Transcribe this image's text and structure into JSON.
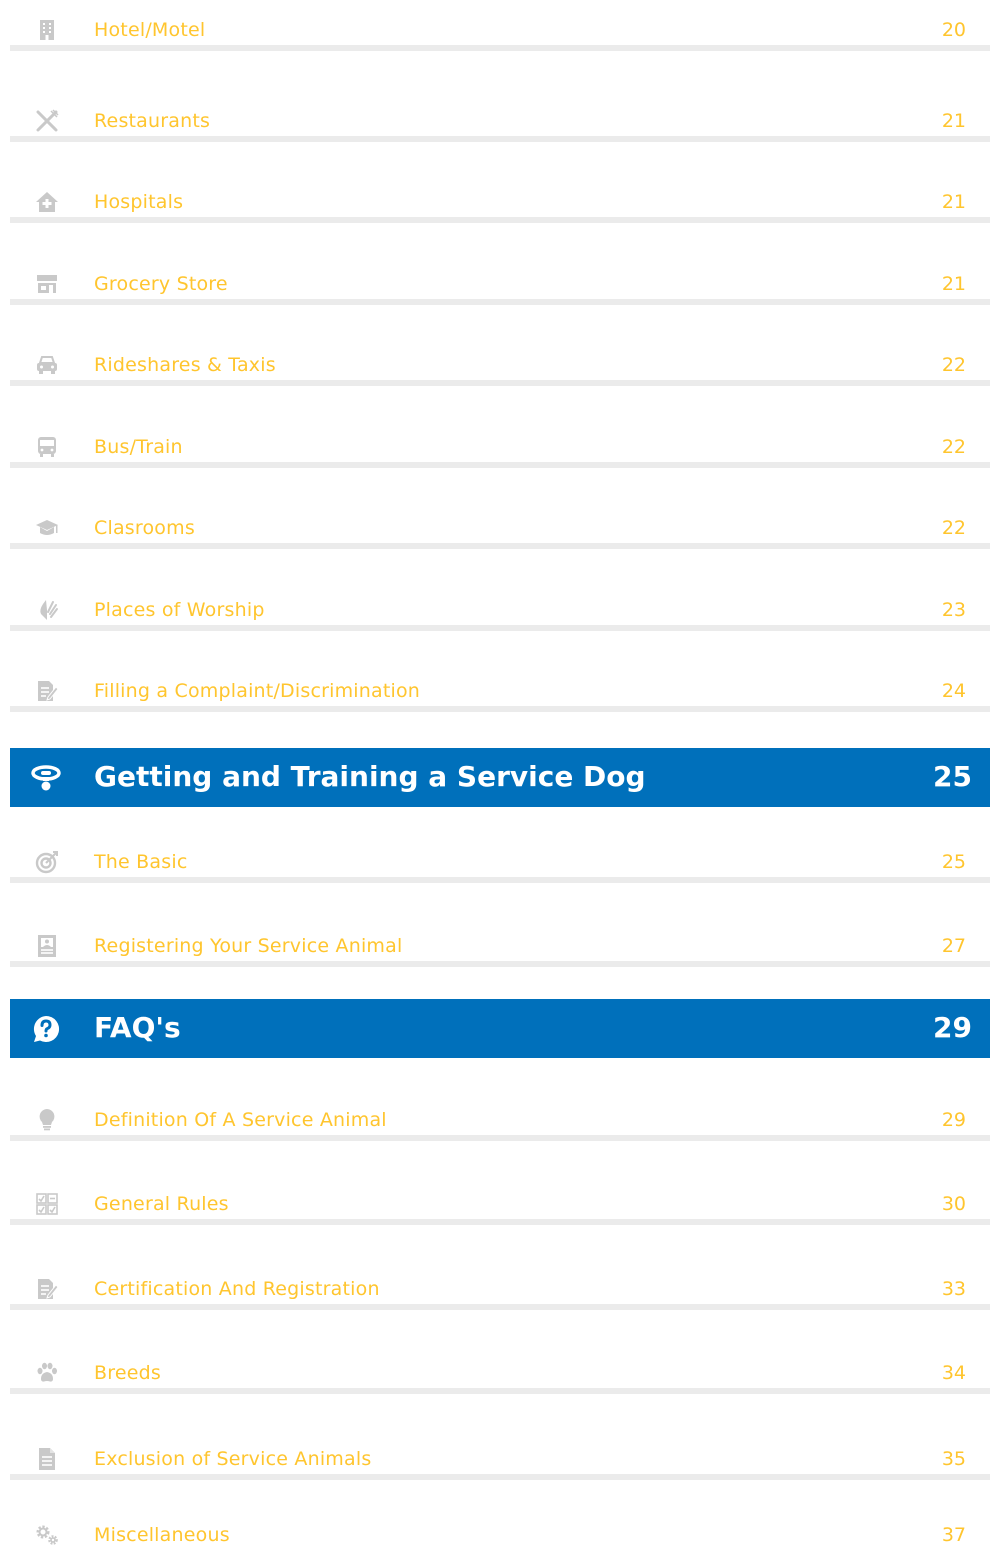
{
  "colors": {
    "entry_text": "#FFC52E",
    "entry_icon": "#C9C9C9",
    "rule": "#EBEBEB",
    "section_bg": "#0070BB",
    "section_text": "#FFFFFF"
  },
  "toc": {
    "entries_1": [
      {
        "label": "Hotel/Motel",
        "page": "20",
        "icon": "building-icon"
      },
      {
        "label": "Restaurants",
        "page": "21",
        "icon": "utensils-icon"
      },
      {
        "label": "Hospitals",
        "page": "21",
        "icon": "hospital-house-icon"
      },
      {
        "label": "Grocery Store",
        "page": "21",
        "icon": "storefront-icon"
      },
      {
        "label": "Rideshares & Taxis",
        "page": "22",
        "icon": "car-icon"
      },
      {
        "label": "Bus/Train",
        "page": "22",
        "icon": "bus-icon"
      },
      {
        "label": "Clasrooms",
        "page": "22",
        "icon": "graduation-cap-icon"
      },
      {
        "label": "Places of Worship",
        "page": "23",
        "icon": "praying-hands-icon"
      },
      {
        "label": "Filling a Complaint/Discrimination",
        "page": "24",
        "icon": "document-edit-icon"
      }
    ],
    "section_training": {
      "label": "Getting and Training a Service Dog",
      "page": "25",
      "icon": "dog-collar-icon"
    },
    "entries_2": [
      {
        "label": "The Basic",
        "page": "25",
        "icon": "target-icon"
      },
      {
        "label": "Registering Your Service Animal",
        "page": "27",
        "icon": "id-document-icon"
      }
    ],
    "section_faq": {
      "label": "FAQ's",
      "page": "29",
      "icon": "question-bubble-icon"
    },
    "entries_3": [
      {
        "label": "Definition Of A Service Animal",
        "page": "29",
        "icon": "lightbulb-icon"
      },
      {
        "label": "General Rules",
        "page": "30",
        "icon": "checklist-grid-icon"
      },
      {
        "label": "Certification And Registration",
        "page": "33",
        "icon": "document-edit-icon"
      },
      {
        "label": "Breeds",
        "page": "34",
        "icon": "paw-icon"
      },
      {
        "label": "Exclusion of Service Animals",
        "page": "35",
        "icon": "document-icon"
      },
      {
        "label": "Miscellaneous",
        "page": "37",
        "icon": "gears-icon"
      }
    ]
  }
}
